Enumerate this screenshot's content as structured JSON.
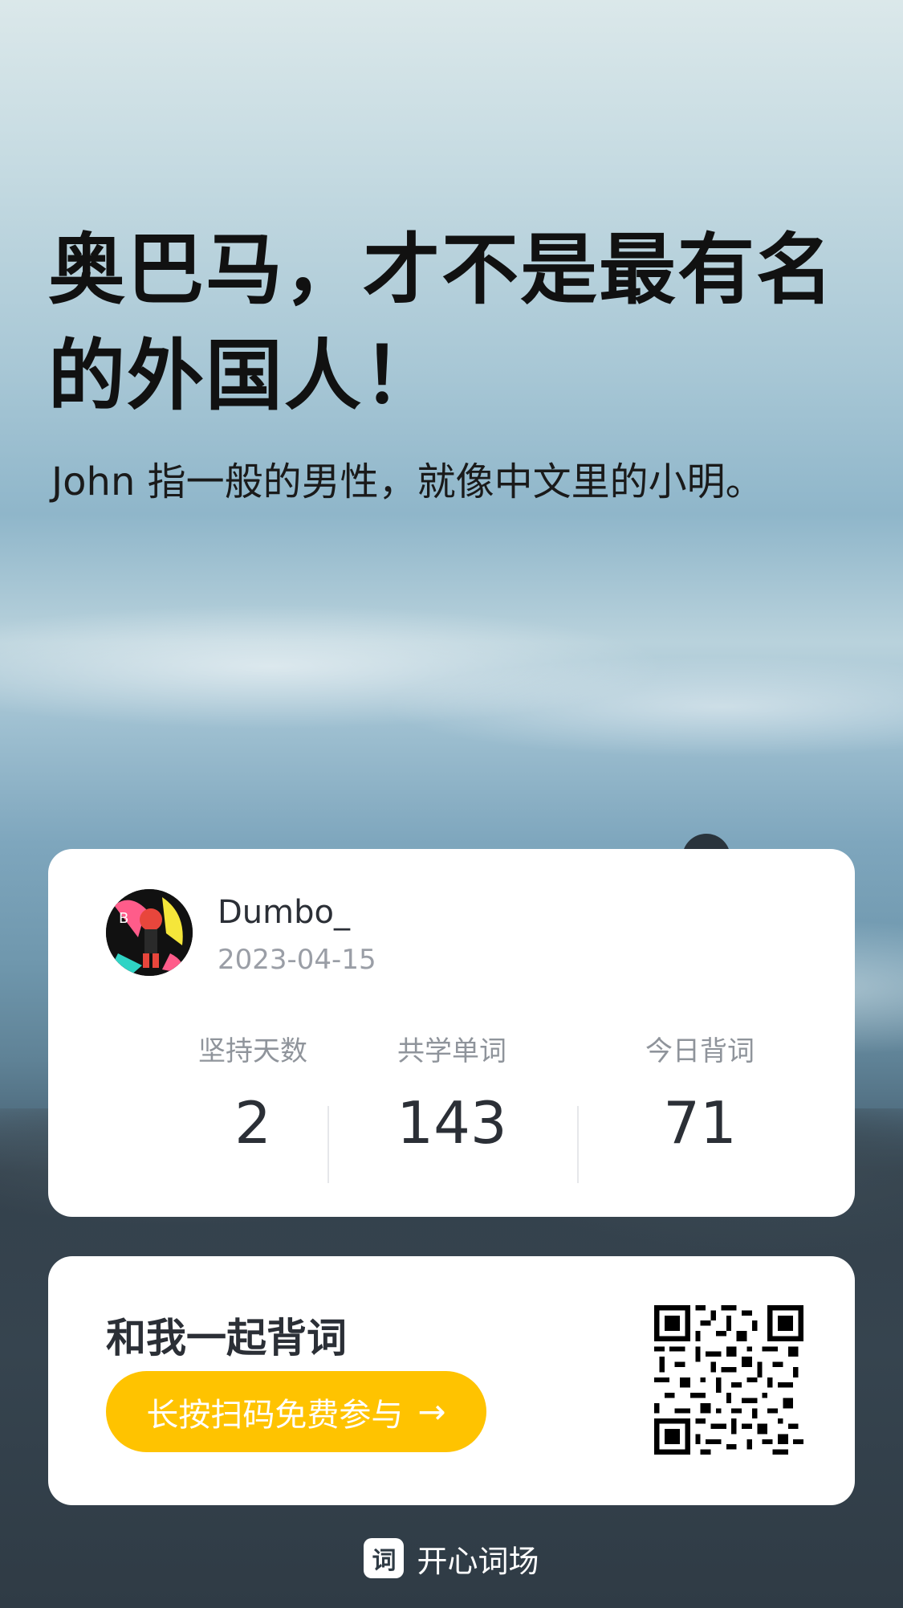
{
  "headline": "奥巴马，才不是最有名的外国人！",
  "subtitle": "John 指一般的男性，就像中文里的小明。",
  "profile": {
    "username": "Dumbo_",
    "date": "2023-04-15",
    "stats": [
      {
        "label": "坚持天数",
        "value": "2"
      },
      {
        "label": "共学单词",
        "value": "143"
      },
      {
        "label": "今日背词",
        "value": "71"
      }
    ]
  },
  "join": {
    "title": "和我一起背词",
    "cta_label": "长按扫码免费参与",
    "cta_arrow": "→"
  },
  "footer": {
    "logo_glyph": "词",
    "brand": "开心词场"
  },
  "colors": {
    "accent": "#ffc300",
    "card_bg": "#ffffff",
    "text_primary": "#2b2f36",
    "text_secondary": "#9a9ea6"
  },
  "icons": {
    "avatar": "avatar-illustration",
    "qr": "qr-code-icon",
    "arrow": "arrow-right-icon",
    "logo": "app-logo-icon"
  }
}
